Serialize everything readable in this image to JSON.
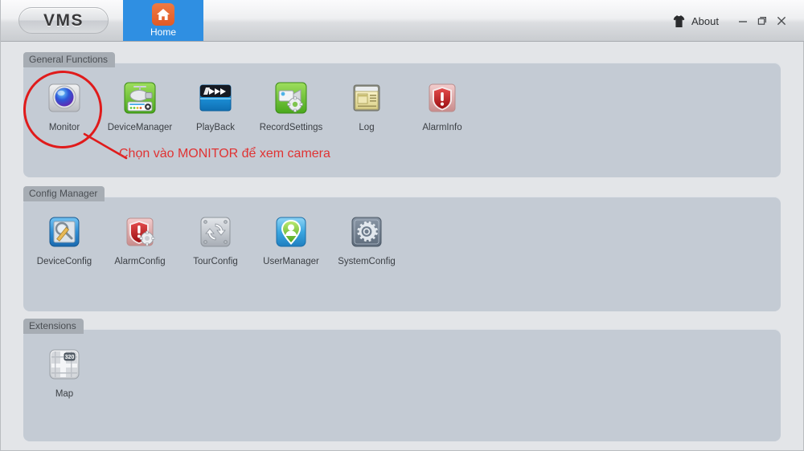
{
  "window": {
    "logo": "VMS",
    "controls": {
      "minimize": "–",
      "maximize": "❐",
      "close": "✕"
    }
  },
  "tabs": [
    {
      "label": "Home",
      "icon": "home-icon",
      "active": true
    }
  ],
  "about": {
    "label": "About",
    "icon": "tshirt-icon"
  },
  "groups": [
    {
      "id": "general",
      "label": "General Functions",
      "items": [
        {
          "label": "Monitor",
          "icon": "dome-camera-icon"
        },
        {
          "label": "DeviceManager",
          "icon": "device-manager-icon"
        },
        {
          "label": "PlayBack",
          "icon": "playback-icon"
        },
        {
          "label": "RecordSettings",
          "icon": "record-settings-icon"
        },
        {
          "label": "Log",
          "icon": "log-icon"
        },
        {
          "label": "AlarmInfo",
          "icon": "alarm-shield-icon"
        }
      ]
    },
    {
      "id": "config",
      "label": "Config Manager",
      "items": [
        {
          "label": "DeviceConfig",
          "icon": "device-config-icon"
        },
        {
          "label": "AlarmConfig",
          "icon": "alarm-config-icon"
        },
        {
          "label": "TourConfig",
          "icon": "tour-config-icon"
        },
        {
          "label": "UserManager",
          "icon": "user-manager-icon"
        },
        {
          "label": "SystemConfig",
          "icon": "system-config-icon"
        }
      ]
    },
    {
      "id": "ext",
      "label": "Extensions",
      "items": [
        {
          "label": "Map",
          "icon": "map-icon",
          "badge": "320"
        }
      ]
    }
  ],
  "annotation": {
    "text": "Chọn vào MONITOR để xem camera",
    "color": "#e03333",
    "target": "Monitor"
  }
}
